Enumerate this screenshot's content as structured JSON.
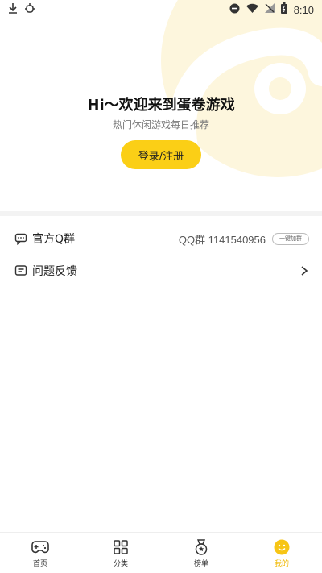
{
  "status_bar": {
    "time": "8:10"
  },
  "hero": {
    "title": "Hi～欢迎来到蛋卷游戏",
    "subtitle": "热门休闲游戏每日推荐",
    "login_button": "登录/注册"
  },
  "menu": {
    "official_group": {
      "label": "官方Q群",
      "qq_text": "QQ群 1141540956",
      "join_button": "一键加群"
    },
    "feedback": {
      "label": "问题反馈"
    }
  },
  "tabs": [
    {
      "label": "首页",
      "icon": "gamepad-icon",
      "active": false
    },
    {
      "label": "分类",
      "icon": "grid-icon",
      "active": false
    },
    {
      "label": "榜单",
      "icon": "medal-icon",
      "active": false
    },
    {
      "label": "我的",
      "icon": "smile-icon",
      "active": true
    }
  ],
  "colors": {
    "accent": "#fbcf16",
    "active_tab": "#f0b800"
  }
}
